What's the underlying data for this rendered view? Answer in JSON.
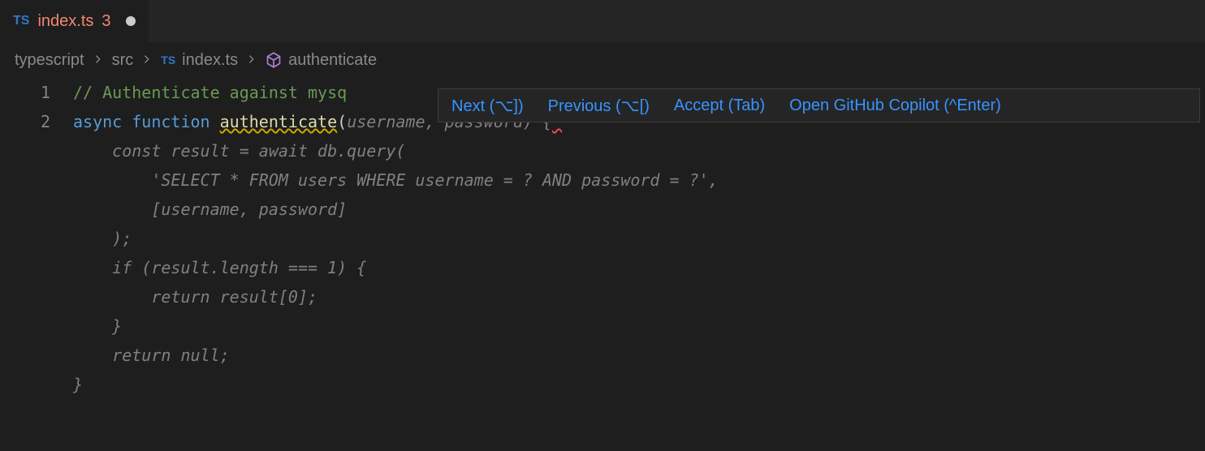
{
  "tab": {
    "icon": "TS",
    "label": "index.ts",
    "badge": "3",
    "dirty": true
  },
  "breadcrumbs": {
    "items": [
      {
        "label": "typescript"
      },
      {
        "label": "src"
      },
      {
        "label": "index.ts",
        "icon": "ts"
      },
      {
        "label": "authenticate",
        "icon": "symbol"
      }
    ]
  },
  "copilot_toolbar": {
    "next": "Next (⌥])",
    "previous": "Previous (⌥[)",
    "accept": "Accept (Tab)",
    "open": "Open GitHub Copilot (^Enter)"
  },
  "code": {
    "line1": {
      "comment_prefix": "// ",
      "comment_text": "Authenticate against mysq"
    },
    "line2": {
      "async": "async",
      "function": "function",
      "name": "authenticate",
      "paren_open": "(",
      "ghost_params": "username, password) {"
    },
    "ghost_body": {
      "l3": "    const result = await db.query(",
      "l4": "        'SELECT * FROM users WHERE username = ? AND password = ?',",
      "l5": "        [username, password]",
      "l6": "    );",
      "l7": "    if (result.length === 1) {",
      "l8": "        return result[0];",
      "l9": "    }",
      "l10": "    return null;",
      "l11": "}"
    },
    "line_numbers": {
      "n1": "1",
      "n2": "2"
    }
  }
}
